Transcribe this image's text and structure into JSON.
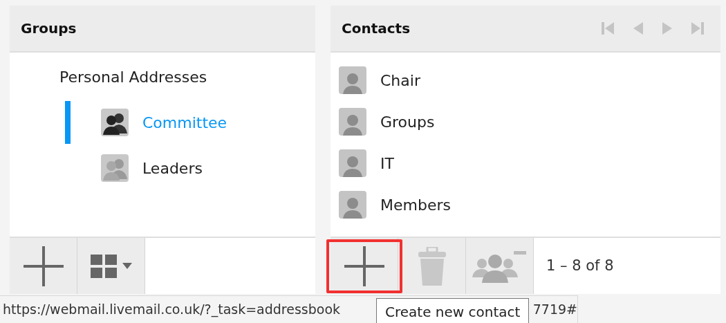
{
  "groups": {
    "title": "Groups",
    "tree": [
      {
        "label": "Personal Addresses",
        "selected": false,
        "children": [
          {
            "label": "Committee",
            "selected": true
          },
          {
            "label": "Leaders",
            "selected": false
          }
        ]
      }
    ]
  },
  "contacts": {
    "title": "Contacts",
    "items": [
      {
        "name": "Chair"
      },
      {
        "name": "Groups"
      },
      {
        "name": "IT"
      },
      {
        "name": "Members"
      }
    ],
    "count": "1 – 8 of 8"
  },
  "status_bar": {
    "url": "https://webmail.livemail.co.uk/?_task=addressbook",
    "url_tail": "7719#"
  },
  "tooltip": "Create new contact"
}
